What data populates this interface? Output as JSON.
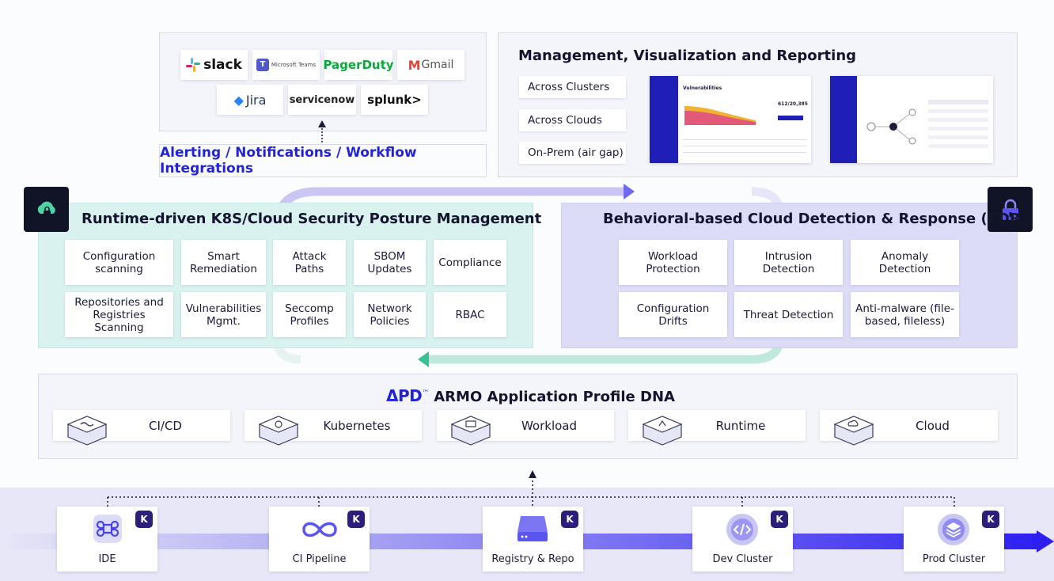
{
  "integrations": {
    "logos": [
      "slack",
      "Microsoft Teams",
      "PagerDuty",
      "Gmail",
      "Jira",
      "servicenow",
      "splunk>"
    ],
    "caption": "Alerting / Notifications / Workflow Integrations"
  },
  "management": {
    "title": "Management, Visualization and Reporting",
    "options": [
      "Across Clusters",
      "Across Clouds",
      "On-Prem (air gap)"
    ],
    "screen1": {
      "heading": "Vulnerabilities",
      "stat": "612/20,385"
    }
  },
  "cspm": {
    "title": "Runtime-driven K8S/Cloud Security Posture Management",
    "icon": "cloud-lock-icon",
    "row1": [
      "Configuration scanning",
      "Smart Remediation",
      "Attack Paths",
      "SBOM Updates",
      "Compliance"
    ],
    "row2": [
      "Repositories and Registries Scanning",
      "Vulnerabilities Mgmt.",
      "Seccomp Profiles",
      "Network Policies",
      "RBAC"
    ]
  },
  "cdr": {
    "title": "Behavioral-based Cloud Detection & Response (CDR)",
    "icon": "lock-icon",
    "row1": [
      "Workload Protection",
      "Intrusion Detection",
      "Anomaly Detection"
    ],
    "row2": [
      "Configuration Drifts",
      "Threat Detection",
      "Anti-malware (file-based, fileless)"
    ]
  },
  "dna": {
    "logo": "ΔPD",
    "tm": "™",
    "title": "ARMO Application Profile DNA",
    "items": [
      "CI/CD",
      "Kubernetes",
      "Workload",
      "Runtime",
      "Cloud"
    ]
  },
  "pipeline": {
    "stages": [
      "IDE",
      "CI Pipeline",
      "Registry & Repo",
      "Dev Cluster",
      "Prod Cluster"
    ],
    "badge": "K"
  },
  "colors": {
    "cspm_bg": "#d9f1ef",
    "cdr_bg": "#dcdcf7",
    "accent": "#5a55f0",
    "green_arrow": "#3dbf95",
    "integration_text": "#2323d6"
  }
}
